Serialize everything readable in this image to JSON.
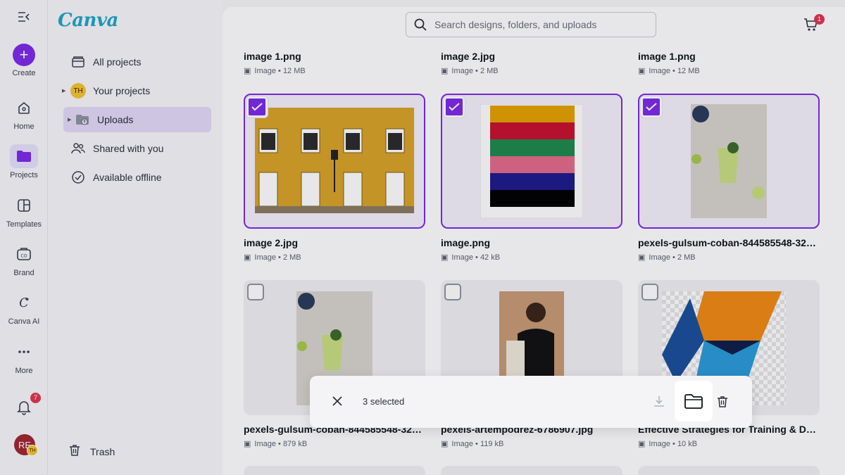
{
  "rail": {
    "create": "Create",
    "home": "Home",
    "projects": "Projects",
    "templates": "Templates",
    "brand": "Brand",
    "canva_ai": "Canva AI",
    "more": "More",
    "notifications_count": "7",
    "avatar_initials": "RE",
    "avatar_small": "TH"
  },
  "nav": {
    "logo": "Canva",
    "items": [
      {
        "label": "All projects"
      },
      {
        "label": "Your projects",
        "avatar": "TH"
      },
      {
        "label": "Uploads"
      },
      {
        "label": "Shared with you"
      },
      {
        "label": "Available offline"
      }
    ],
    "trash": "Trash"
  },
  "topbar": {
    "search_placeholder": "Search designs, folders, and uploads",
    "cart_count": "1"
  },
  "files": [
    {
      "name": "image 1.png",
      "meta": "Image • 12 MB"
    },
    {
      "name": "image 2.jpg",
      "meta": "Image • 2 MB"
    },
    {
      "name": "image 1.png",
      "meta": "Image • 12 MB"
    },
    {
      "name": "image 2.jpg",
      "meta": "Image • 2 MB",
      "selected": true
    },
    {
      "name": "image.png",
      "meta": "Image • 42 kB",
      "selected": true
    },
    {
      "name": "pexels-gulsum-coban-844585548-3275...",
      "meta": "Image • 2 MB",
      "selected": true
    },
    {
      "name": "pexels-gulsum-coban-844585548-3275...",
      "meta": "Image • 879 kB"
    },
    {
      "name": "pexels-artempodrez-6786907.jpg",
      "meta": "Image • 119 kB"
    },
    {
      "name": "Effective Strategies for Training & Dev...",
      "meta": "Image • 10 kB"
    }
  ],
  "selection_bar": {
    "count_label": "3 selected"
  },
  "colors": {
    "accent": "#7d2ae8",
    "stripes": [
      "#e5a100",
      "#c8102e",
      "#1f8a4c",
      "#e46a8a",
      "#1e1a8c",
      "#000000"
    ]
  }
}
